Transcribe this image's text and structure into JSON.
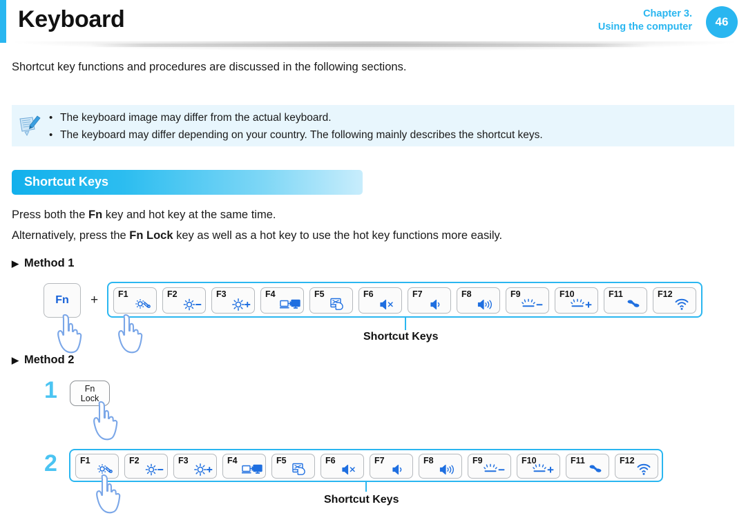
{
  "header": {
    "title": "Keyboard",
    "chapter_line1": "Chapter 3.",
    "chapter_line2": "Using the computer",
    "page_number": "46",
    "accent_color": "#29b6f0"
  },
  "intro": {
    "text": "Shortcut key functions and procedures are discussed in the following sections."
  },
  "note": {
    "icon": "note-pencil-icon",
    "background_color": "#e8f6fd",
    "items": [
      "The keyboard image may differ from the actual keyboard.",
      "The keyboard may differ depending on your country. The following mainly describes the shortcut keys."
    ]
  },
  "section": {
    "title": "Shortcut Keys"
  },
  "body": {
    "line1_pre": "Press both the ",
    "line1_bold": "Fn",
    "line1_post": " key and hot key at the same time.",
    "line2_pre": "Alternatively, press the ",
    "line2_bold": "Fn Lock",
    "line2_post": " key as well as a hot key to use the hot key functions more easily."
  },
  "methods": [
    {
      "heading": "Method 1",
      "fn_key_label": "Fn",
      "plus": "+",
      "callout_label": "Shortcut Keys"
    },
    {
      "heading": "Method 2",
      "step1_number": "1",
      "step2_number": "2",
      "fnlock_line1": "Fn",
      "fnlock_line2": "Lock",
      "callout_label": "Shortcut Keys"
    }
  ],
  "function_keys": [
    {
      "label": "F1",
      "icon": "settings-gear-icon"
    },
    {
      "label": "F2",
      "icon": "brightness-down-icon"
    },
    {
      "label": "F3",
      "icon": "brightness-up-icon"
    },
    {
      "label": "F4",
      "icon": "external-display-icon"
    },
    {
      "label": "F5",
      "icon": "touchpad-off-icon"
    },
    {
      "label": "F6",
      "icon": "volume-mute-icon"
    },
    {
      "label": "F7",
      "icon": "volume-down-icon"
    },
    {
      "label": "F8",
      "icon": "volume-up-icon"
    },
    {
      "label": "F9",
      "icon": "keyboard-backlight-down-icon"
    },
    {
      "label": "F10",
      "icon": "keyboard-backlight-up-icon"
    },
    {
      "label": "F11",
      "icon": "fan-silent-mode-icon"
    },
    {
      "label": "F12",
      "icon": "wireless-wifi-icon"
    }
  ],
  "colors": {
    "accent": "#29b6f0",
    "icon_blue": "#1f6fe0",
    "step_number": "#4bc4f2",
    "hand_outline": "#7ba7e8"
  }
}
